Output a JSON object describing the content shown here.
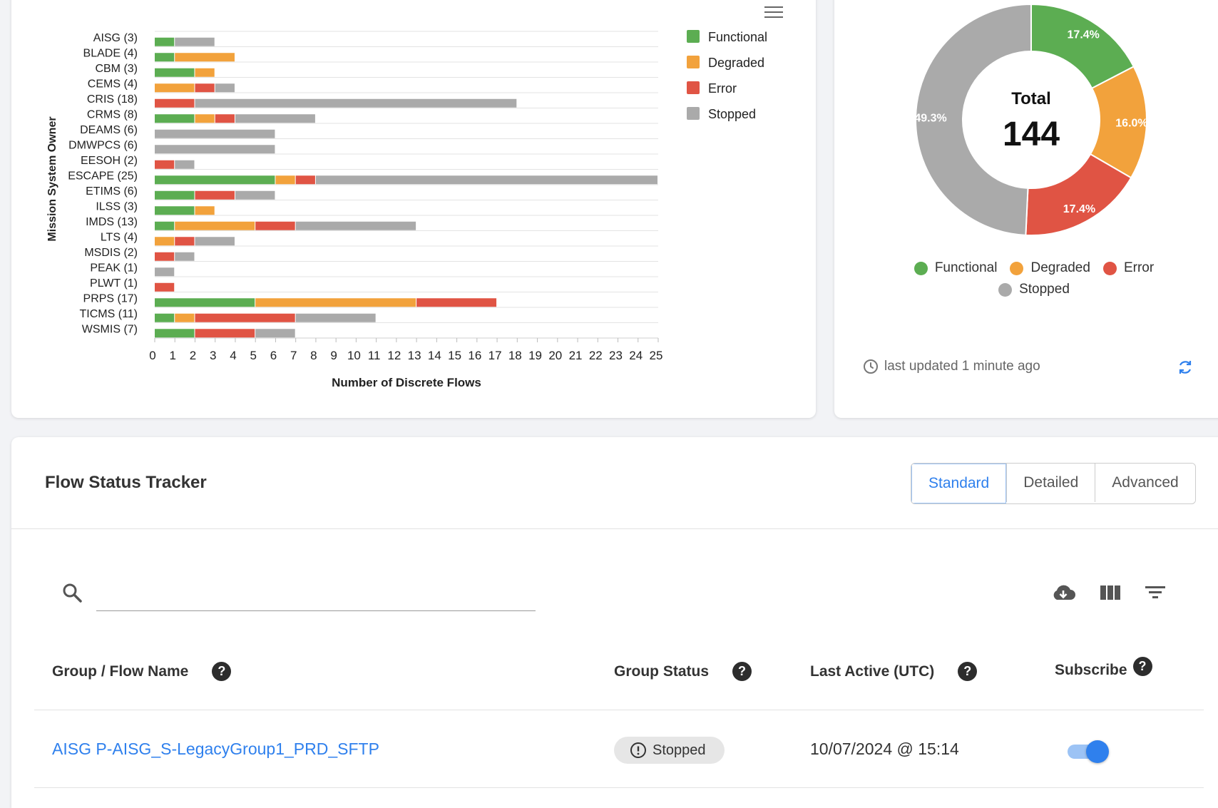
{
  "bar_chart": {
    "chart_data": {
      "type": "bar",
      "orientation": "horizontal",
      "stacked": true,
      "categories": [
        "AISG (3)",
        "BLADE (4)",
        "CBM (3)",
        "CEMS (4)",
        "CRIS (18)",
        "CRMS (8)",
        "DEAMS (6)",
        "DMWPCS (6)",
        "EESOH (2)",
        "ESCAPE (25)",
        "ETIMS (6)",
        "ILSS (3)",
        "IMDS (13)",
        "LTS (4)",
        "MSDIS (2)",
        "PEAK (1)",
        "PLWT (1)",
        "PRPS (17)",
        "TICMS (11)",
        "WSMIS (7)"
      ],
      "series": [
        {
          "name": "Functional",
          "color": "#5cad52",
          "values": [
            1,
            1,
            2,
            0,
            0,
            2,
            0,
            0,
            0,
            6,
            2,
            2,
            1,
            0,
            0,
            0,
            0,
            5,
            1,
            2
          ]
        },
        {
          "name": "Degraded",
          "color": "#f2a23c",
          "values": [
            0,
            3,
            1,
            2,
            0,
            1,
            0,
            0,
            0,
            1,
            0,
            1,
            4,
            1,
            0,
            0,
            0,
            8,
            1,
            0
          ]
        },
        {
          "name": "Error",
          "color": "#e05444",
          "values": [
            0,
            0,
            0,
            1,
            2,
            1,
            0,
            0,
            1,
            1,
            2,
            0,
            2,
            1,
            1,
            0,
            1,
            4,
            5,
            3
          ]
        },
        {
          "name": "Stopped",
          "color": "#aaaaaa",
          "values": [
            2,
            0,
            0,
            1,
            16,
            4,
            6,
            6,
            1,
            17,
            2,
            0,
            6,
            2,
            1,
            1,
            0,
            0,
            4,
            2
          ]
        }
      ],
      "xlabel": "Number of Discrete Flows",
      "ylabel": "Mission System Owner",
      "xlim": [
        0,
        25
      ],
      "xticks": [
        "0",
        "1",
        "2",
        "3",
        "4",
        "5",
        "6",
        "7",
        "8",
        "9",
        "10",
        "11",
        "12",
        "13",
        "14",
        "15",
        "16",
        "17",
        "18",
        "19",
        "20",
        "21",
        "22",
        "23",
        "24",
        "25"
      ],
      "grid": true,
      "legend_position": "right"
    }
  },
  "donut_chart": {
    "chart_data": {
      "type": "pie",
      "variant": "donut",
      "labels": [
        "Functional",
        "Degraded",
        "Error",
        "Stopped"
      ],
      "percent_labels": [
        "17.4%",
        "16.0%",
        "17.4%",
        "49.3%"
      ],
      "values": [
        17.4,
        16.0,
        17.4,
        49.3
      ],
      "colors": [
        "#5cad52",
        "#f2a23c",
        "#e05444",
        "#aaaaaa"
      ],
      "center_title": "Total",
      "center_value": "144"
    },
    "legend": [
      "Functional",
      "Degraded",
      "Error",
      "Stopped"
    ],
    "last_updated": "last updated 1 minute ago"
  },
  "tracker": {
    "title": "Flow Status Tracker",
    "views": [
      "Standard",
      "Detailed",
      "Advanced"
    ],
    "active_view": "Standard",
    "search": {
      "value": "",
      "placeholder": ""
    },
    "toolbar_icons": [
      "cloud-download-icon",
      "columns-icon",
      "filter-icon"
    ],
    "columns": [
      "Group / Flow Name",
      "Group Status",
      "Last Active (UTC)",
      "Subscribe"
    ],
    "rows": [
      {
        "name": "AISG P-AISG_S-LegacyGroup1_PRD_SFTP",
        "status": "Stopped",
        "last_active": "10/07/2024 @ 15:14",
        "subscribed": true
      }
    ]
  }
}
